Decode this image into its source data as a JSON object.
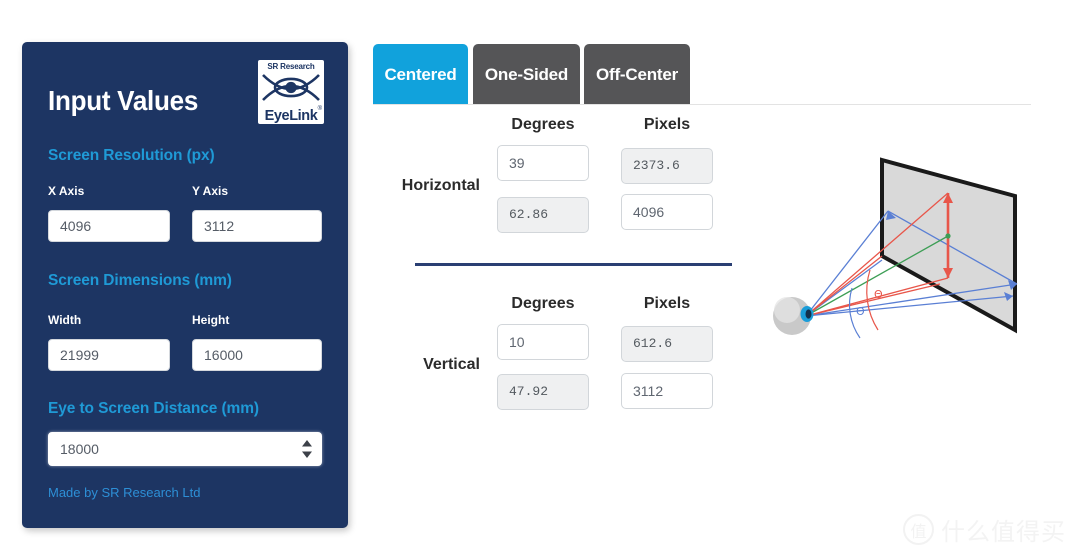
{
  "sidebar": {
    "title": "Input Values",
    "logo": {
      "top_text": "SR Research",
      "bottom_text": "EyeLink",
      "registered_mark": "®",
      "eye_icon": "eye-logo-icon"
    },
    "sections": [
      {
        "heading": "Screen Resolution (px)",
        "fields": [
          {
            "label": "X Axis",
            "value": "4096"
          },
          {
            "label": "Y Axis",
            "value": "3112"
          }
        ]
      },
      {
        "heading": "Screen Dimensions (mm)",
        "fields": [
          {
            "label": "Width",
            "value": "21999"
          },
          {
            "label": "Height",
            "value": "16000"
          }
        ]
      }
    ],
    "distance": {
      "heading": "Eye to Screen Distance (mm)",
      "value": "18000",
      "spinner_up": "spinner-up-icon",
      "spinner_down": "spinner-down-icon"
    },
    "credit": "Made by SR Research Ltd"
  },
  "tabs": [
    {
      "label": "Centered",
      "active": true
    },
    {
      "label": "One-Sided",
      "active": false
    },
    {
      "label": "Off-Center",
      "active": false
    }
  ],
  "results": {
    "columns": [
      "Degrees",
      "Pixels"
    ],
    "rows": [
      {
        "label": "Horizontal",
        "degrees_top": "39",
        "pixels_top": "2373.6",
        "degrees_bottom": "62.86",
        "pixels_bottom": "4096"
      },
      {
        "label": "Vertical",
        "degrees_top": "10",
        "pixels_top": "612.6",
        "degrees_bottom": "47.92",
        "pixels_bottom": "3112"
      }
    ]
  },
  "diagram": {
    "name": "visual-angle-diagram",
    "theta_horizontal": "Θ",
    "theta_vertical": "Θ",
    "colors": {
      "horizontal_angle": "#5a7fd4",
      "vertical_angle": "#e8564a",
      "center_line": "#3d9e55",
      "screen_fill": "#d9d9d9",
      "screen_edge": "#1a1a1a",
      "eye": "#1b9dd9"
    }
  },
  "watermark": {
    "logo_char": "值",
    "text": "什么值得买"
  },
  "theme": {
    "sidebar_bg": "#1d3563",
    "accent_blue": "#1f9ad6",
    "tab_active": "#11a2dc",
    "tab_inactive": "#555557",
    "divider": "#2a3f73"
  }
}
